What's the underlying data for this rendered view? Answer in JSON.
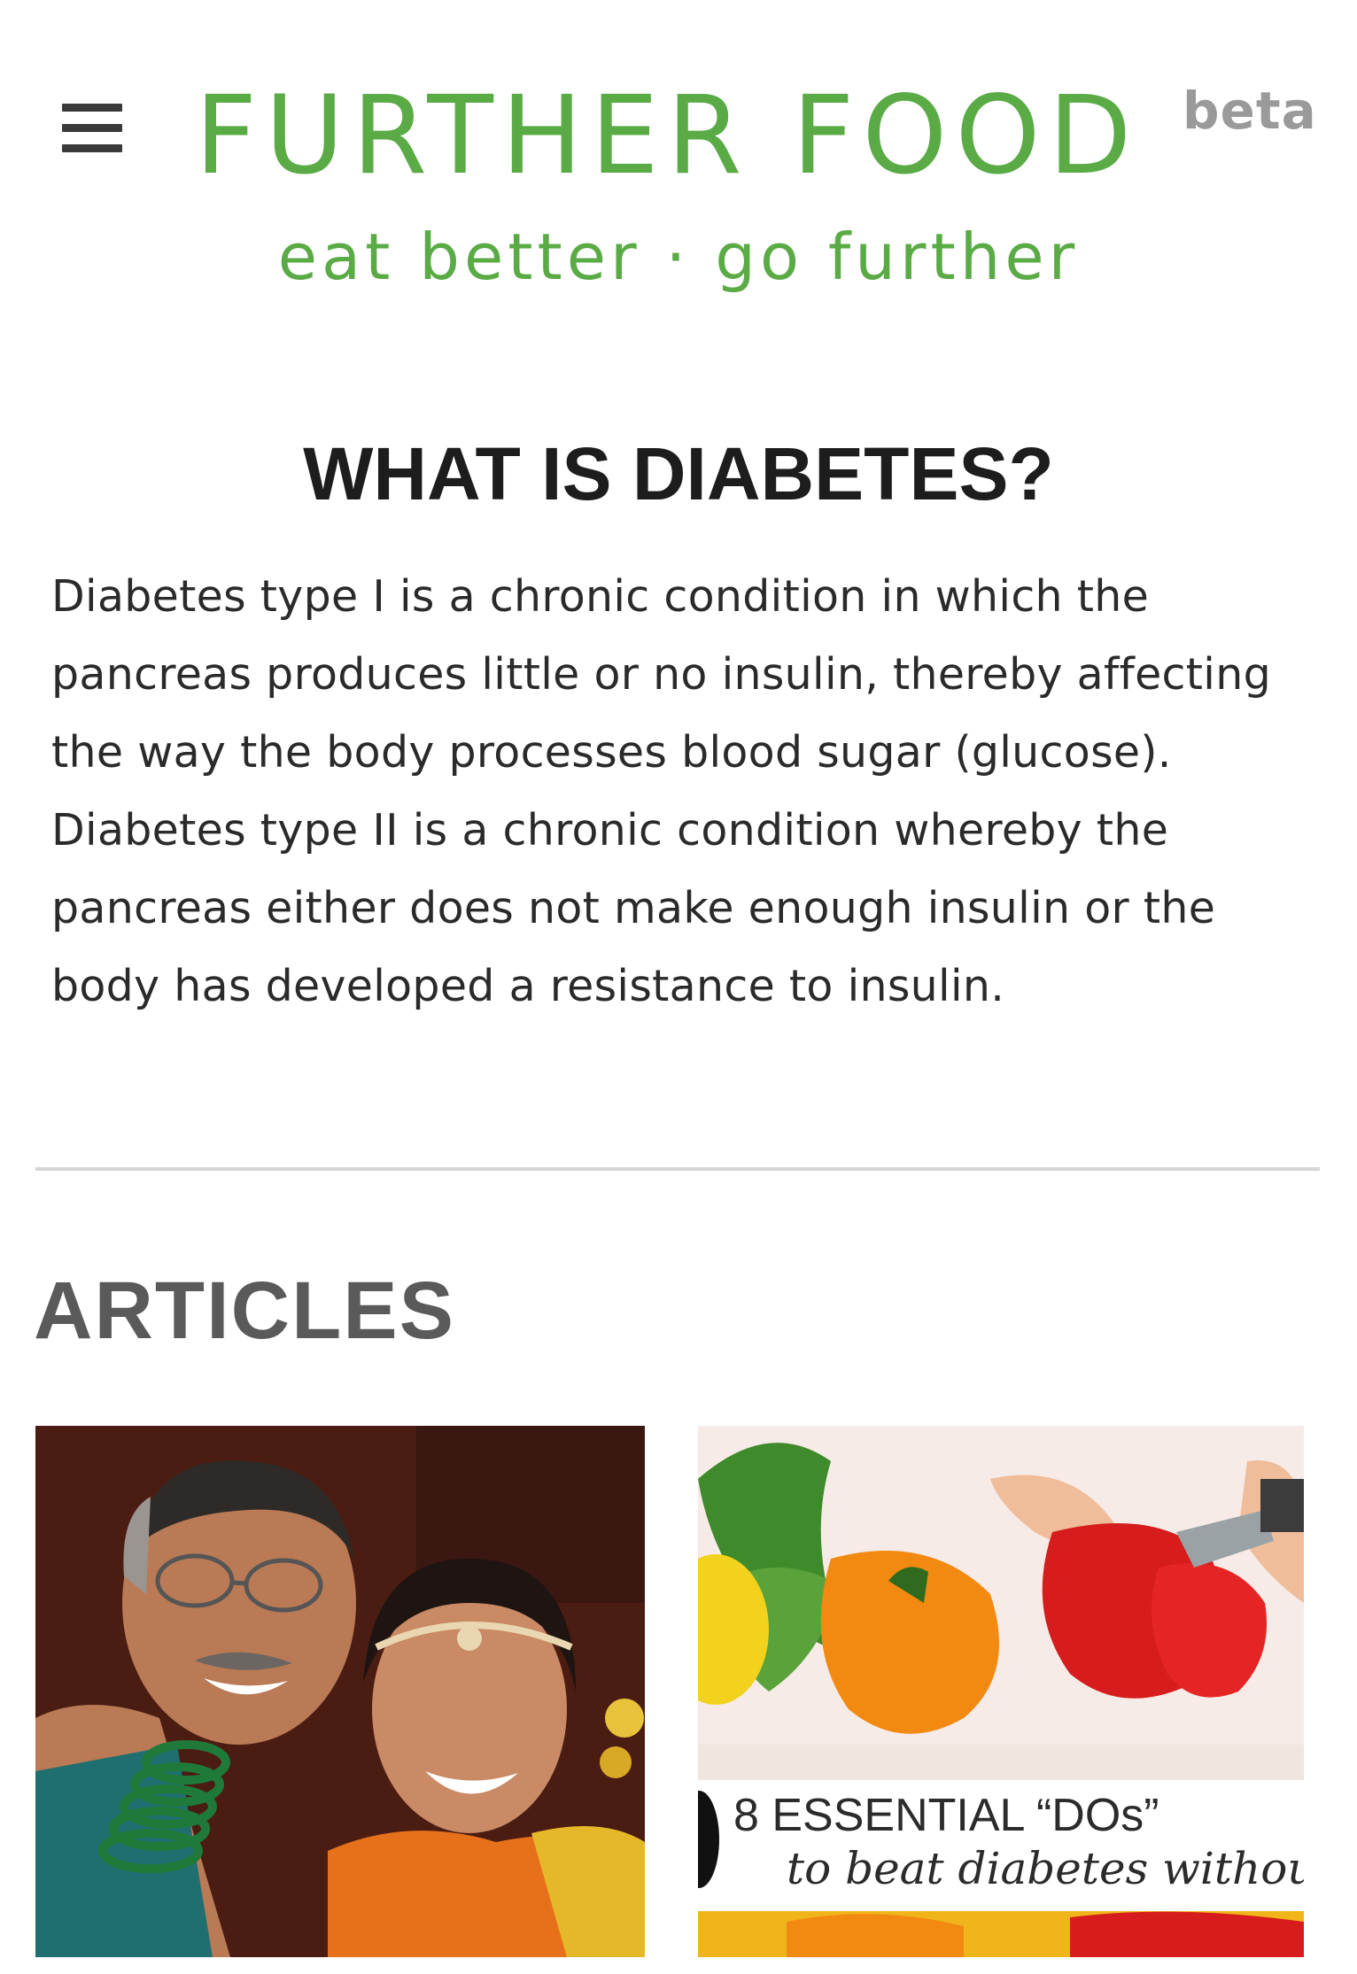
{
  "header": {
    "menu_icon": "hamburger-menu-icon",
    "brand": "FURTHER FOOD",
    "beta": "beta",
    "tagline": "eat better · go further",
    "brand_color": "#5aab46"
  },
  "intro": {
    "heading": "WHAT IS DIABETES?",
    "body": "Diabetes type I is a chronic condition in which the pancreas produces little or no insulin, thereby affecting the way the body processes blood sugar (glucose). Diabetes type II is a chronic condition whereby the pancreas either does not make enough insulin or the body has developed a resistance to insulin."
  },
  "articles": {
    "heading": "ARTICLES",
    "items": [
      {
        "image": "smiling-father-and-daughter-photo"
      },
      {
        "image": "vegetables-bell-peppers-photo",
        "caption_line1": "8 ESSENTIAL “DOs”",
        "caption_line2": "to beat diabetes without"
      }
    ]
  }
}
